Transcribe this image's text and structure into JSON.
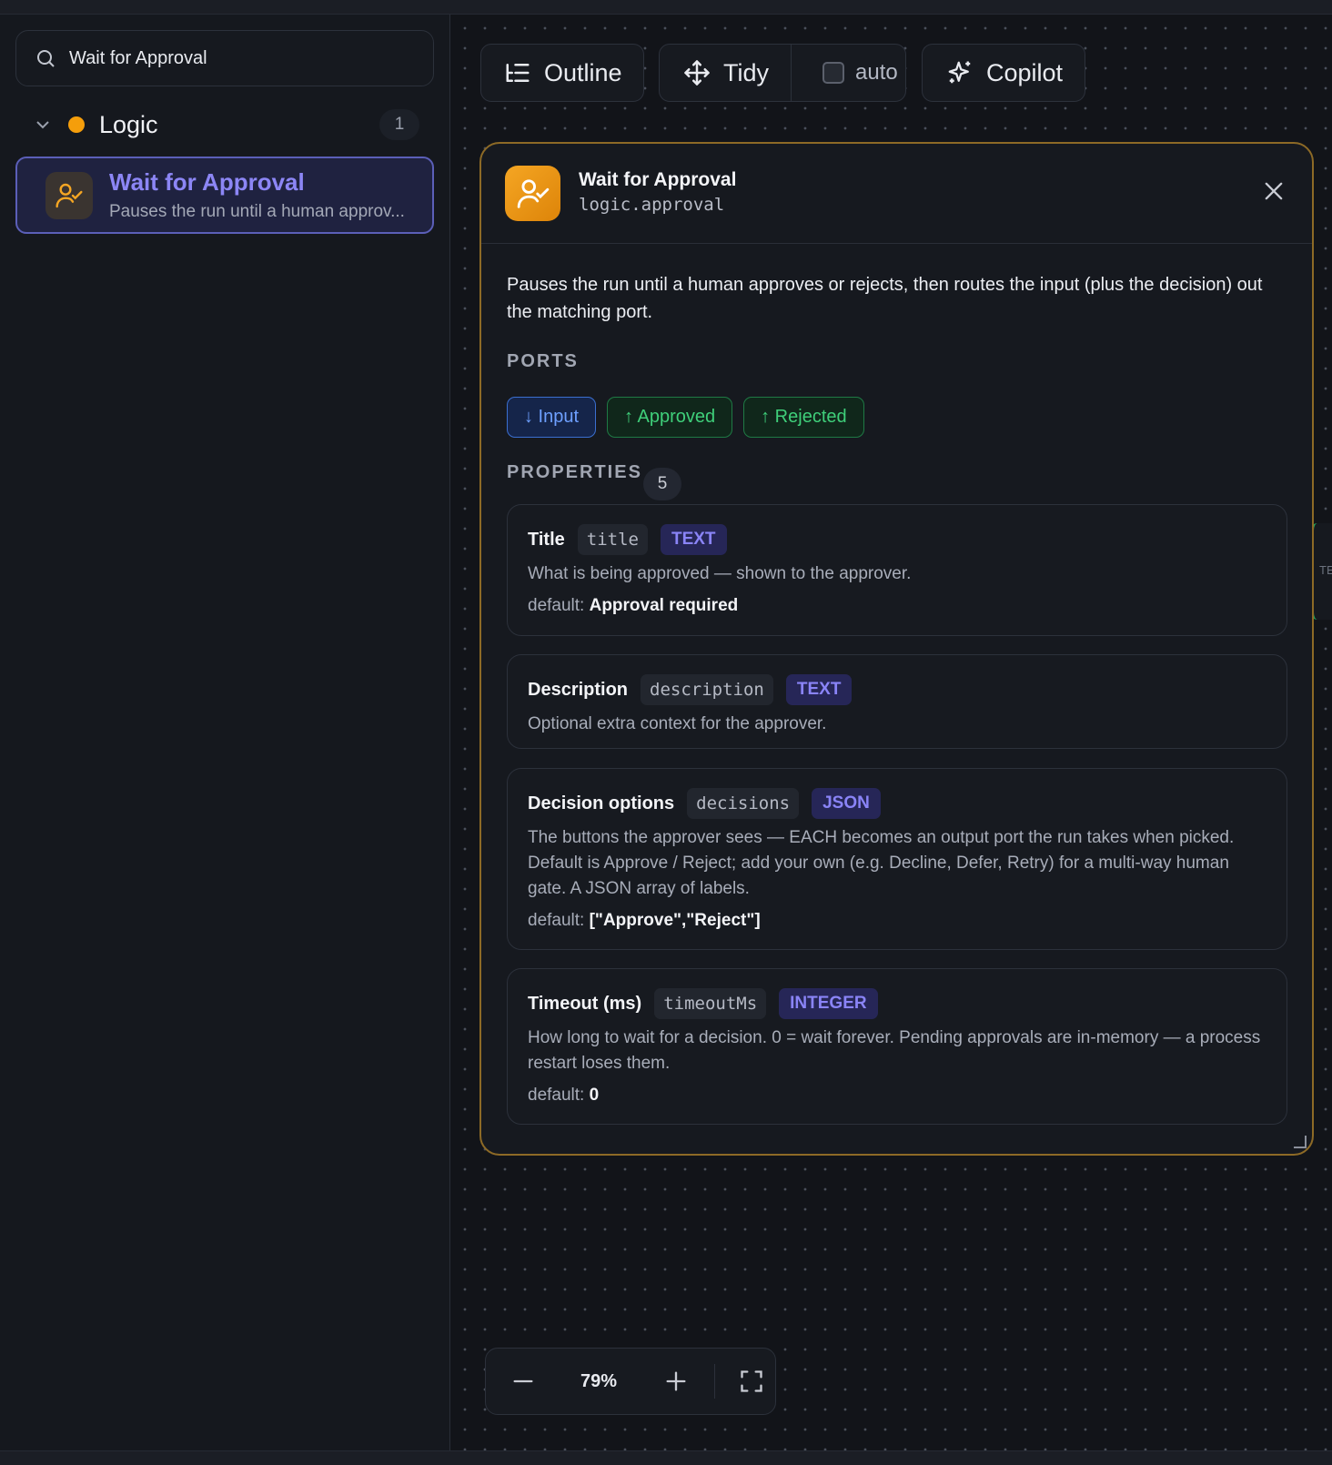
{
  "search": {
    "value": "Wait for Approval"
  },
  "sidebar": {
    "group": {
      "name": "Logic",
      "count": "1",
      "color": "#f59e0b"
    },
    "item": {
      "title": "Wait for Approval",
      "subtitle": "Pauses the run until a human approv..."
    }
  },
  "toolbar": {
    "outline_label": "Outline",
    "tidy_label": "Tidy",
    "auto_label": "auto",
    "copilot_label": "Copilot"
  },
  "side_peek": {
    "text": "TE"
  },
  "panel": {
    "title": "Wait for Approval",
    "type": "logic.approval",
    "description": "Pauses the run until a human approves or rejects, then routes the input (plus the decision) out the matching port.",
    "ports_label": "PORTS",
    "ports": [
      {
        "label": "↓ Input"
      },
      {
        "label": "↑ Approved"
      },
      {
        "label": "↑ Rejected"
      }
    ],
    "properties_label": "PROPERTIES",
    "properties_count": "5",
    "properties": [
      {
        "label": "Title",
        "key": "title",
        "type": "TEXT",
        "description": "What is being approved — shown to the approver.",
        "default_prefix": "default:",
        "default": "Approval required"
      },
      {
        "label": "Description",
        "key": "description",
        "type": "TEXT",
        "description": "Optional extra context for the approver."
      },
      {
        "label": "Decision options",
        "key": "decisions",
        "type": "JSON",
        "description": "The buttons the approver sees — EACH becomes an output port the run takes when picked. Default is Approve / Reject; add your own (e.g. Decline, Defer, Retry) for a multi-way human gate. A JSON array of labels.",
        "default_prefix": "default:",
        "default": "[\"Approve\",\"Reject\"]"
      },
      {
        "label": "Timeout (ms)",
        "key": "timeoutMs",
        "type": "INTEGER",
        "description": "How long to wait for a decision. 0 = wait forever. Pending approvals are in-memory — a process restart loses them.",
        "default_prefix": "default:",
        "default": "0"
      }
    ]
  },
  "zoom": {
    "value": "79%"
  },
  "icons": {
    "search": "search-icon",
    "chevron": "chevron-down-icon",
    "node": "user-check-icon",
    "outline": "outline-list-icon",
    "tidy": "move-arrows-icon",
    "copilot": "sparkles-icon",
    "close": "close-icon",
    "zoom_out": "minus-icon",
    "zoom_in": "plus-icon",
    "fit": "fit-screen-icon"
  },
  "colors": {
    "accent": "#8c86f5",
    "approval": "#f5a623",
    "input_port": "#6ea0ff",
    "output_port": "#3fcf7a"
  }
}
